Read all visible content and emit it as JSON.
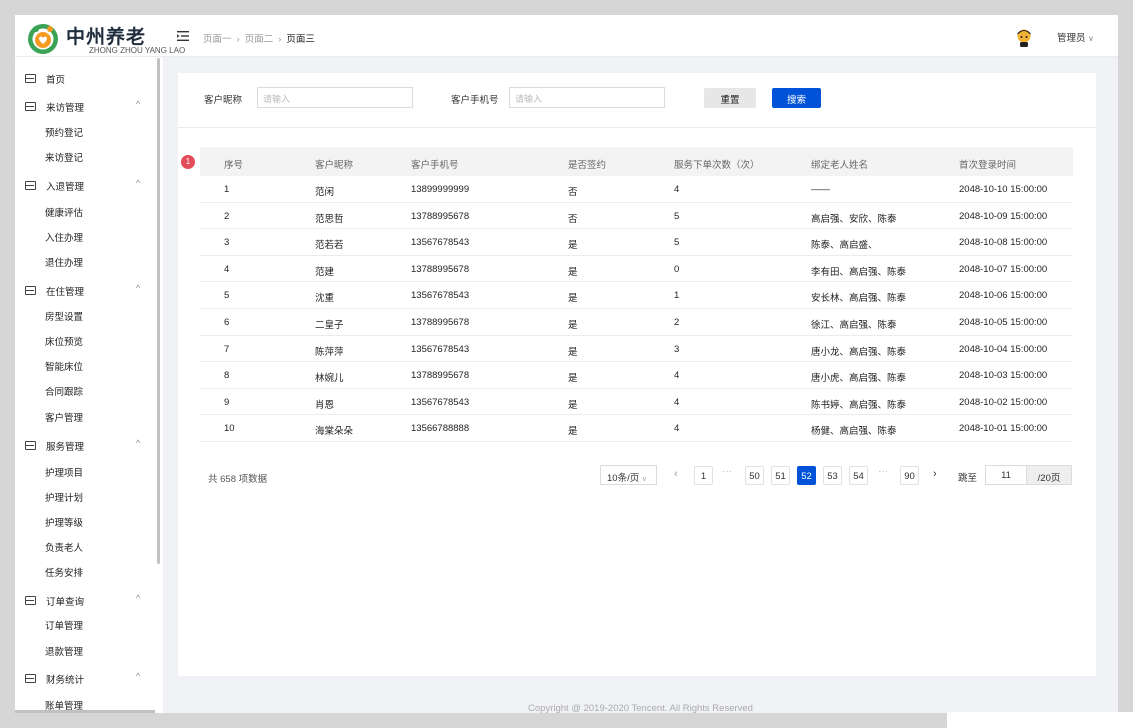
{
  "brand": {
    "cn": "中州养老",
    "en": "ZHONG ZHOU YANG LAO"
  },
  "colors": {
    "primary": "#0052d9",
    "badge": "#e34d59",
    "logo_green": "#3aa356",
    "logo_orange": "#f59a23"
  },
  "breadcrumb": [
    "页面一",
    "页面二",
    "页面三"
  ],
  "user": {
    "name": "管理员"
  },
  "icons": {
    "collapse": "menu-fold-icon",
    "avatar": "user-avatar-icon",
    "group": "menu-group-icon",
    "chevron": "chevron-up-icon",
    "dropdown": "chevron-down-icon"
  },
  "sidebar": {
    "home": "首页",
    "groups": [
      {
        "label": "来访管理",
        "items": [
          "预约登记",
          "来访登记"
        ]
      },
      {
        "label": "入退管理",
        "items": [
          "健康评估",
          "入住办理",
          "退住办理"
        ]
      },
      {
        "label": "在住管理",
        "items": [
          "房型设置",
          "床位预览",
          "智能床位",
          "合同跟踪",
          "客户管理"
        ]
      },
      {
        "label": "服务管理",
        "items": [
          "护理项目",
          "护理计划",
          "护理等级",
          "负责老人",
          "任务安排"
        ]
      },
      {
        "label": "订单查询",
        "items": [
          "订单管理",
          "退款管理"
        ]
      },
      {
        "label": "财务统计",
        "items": [
          "账单管理"
        ]
      }
    ]
  },
  "filters": {
    "nickname": {
      "label": "客户昵称",
      "placeholder": "请输入"
    },
    "phone": {
      "label": "客户手机号",
      "placeholder": "请输入"
    },
    "reset": "重置",
    "search": "搜索"
  },
  "badge": "1",
  "table": {
    "columns": [
      "序号",
      "客户昵称",
      "客户手机号",
      "是否签约",
      "服务下单次数（次）",
      "绑定老人姓名",
      "首次登录时间"
    ],
    "rows": [
      [
        "1",
        "范闲",
        "13899999999",
        "否",
        "4",
        "——",
        "2048-10-10 15:00:00"
      ],
      [
        "2",
        "范思哲",
        "13788995678",
        "否",
        "5",
        "高启强、安欣、陈泰",
        "2048-10-09 15:00:00"
      ],
      [
        "3",
        "范若若",
        "13567678543",
        "是",
        "5",
        "陈泰、高启盛、",
        "2048-10-08 15:00:00"
      ],
      [
        "4",
        "范建",
        "13788995678",
        "是",
        "0",
        "李有田、高启强、陈泰",
        "2048-10-07 15:00:00"
      ],
      [
        "5",
        "沈重",
        "13567678543",
        "是",
        "1",
        "安长林、高启强、陈泰",
        "2048-10-06 15:00:00"
      ],
      [
        "6",
        "二皇子",
        "13788995678",
        "是",
        "2",
        "徐江、高启强、陈泰",
        "2048-10-05 15:00:00"
      ],
      [
        "7",
        "陈萍萍",
        "13567678543",
        "是",
        "3",
        "唐小龙、高启强、陈泰",
        "2048-10-04 15:00:00"
      ],
      [
        "8",
        "林婉儿",
        "13788995678",
        "是",
        "4",
        "唐小虎、高启强、陈泰",
        "2048-10-03 15:00:00"
      ],
      [
        "9",
        "肖恩",
        "13567678543",
        "是",
        "4",
        "陈书婷、高启强、陈泰",
        "2048-10-02 15:00:00"
      ],
      [
        "10",
        "海棠朵朵",
        "13566788888",
        "是",
        "4",
        "杨健、高启强、陈泰",
        "2048-10-01 15:00:00"
      ]
    ]
  },
  "pagination": {
    "total": "共 658 项数据",
    "page_size": "10条/页",
    "pages": [
      "1",
      "50",
      "51",
      "52",
      "53",
      "54",
      "90"
    ],
    "current": "52",
    "jump_label": "跳至",
    "jump_value": "11",
    "jump_suffix": "/20页"
  },
  "footer": "Copyright @ 2019-2020 Tencent. All Rights Reserved"
}
